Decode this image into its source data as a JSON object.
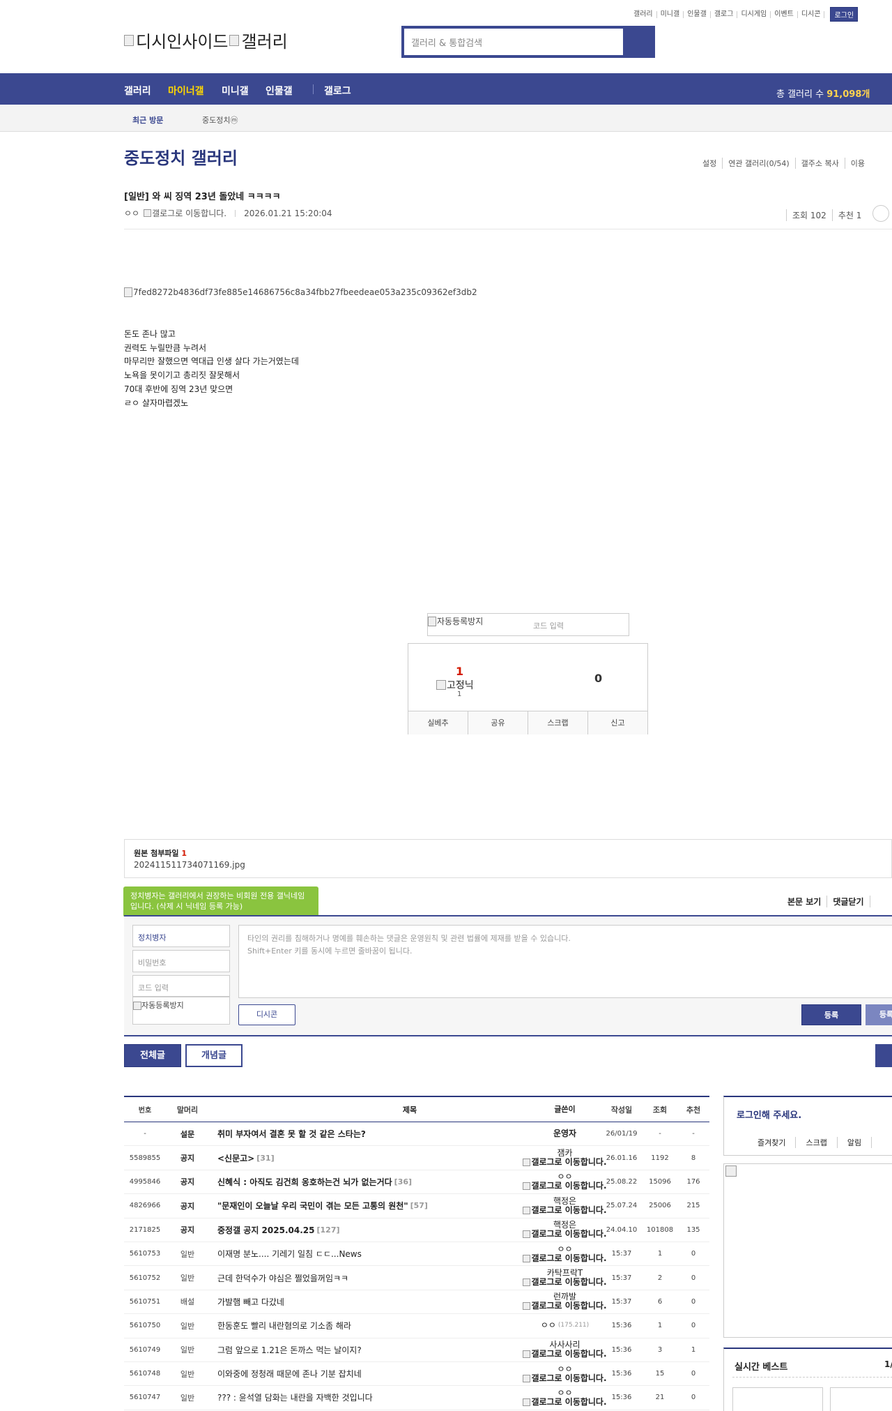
{
  "top_links": [
    "갤러리",
    "미니갤",
    "인물갤",
    "갤로그",
    "디시게임",
    "이벤트",
    "디시콘"
  ],
  "login_label": "로그인",
  "logo": {
    "left": "디시인사이드",
    "right": "갤러리"
  },
  "search": {
    "placeholder": "갤러리 & 통합검색"
  },
  "gnb": {
    "items": [
      "갤러리",
      "마이너갤",
      "미니갤",
      "인물갤",
      "갤로그"
    ],
    "active": "마이너갤",
    "total_label": "총 갤러리 수",
    "total_value": "91,098개"
  },
  "recent": {
    "label": "최근 방문",
    "gallery": "중도정치",
    "badge": "ⓜ"
  },
  "gallery_title": "중도정치 갤러리",
  "gallery_tools": [
    "설정",
    "연관 갤러리(0/54)",
    "갤주소 복사",
    "이용"
  ],
  "post": {
    "title": "[일반] 와 씨 징역 23년 돌았네 ㅋㅋㅋㅋ",
    "author": "ㅇㅇ",
    "gallog_alt": "갤로그로 이동합니다.",
    "date": "2026.01.21 15:20:04",
    "views": "조회 102",
    "recommend": "추천 1",
    "image_alt": "7fed8272b4836df73fe885e14686756c8a34fbb27fbeedeae053a235c09362ef3db2",
    "content_lines": [
      "돈도 존나 많고",
      "권력도 누릴만큼 누려서",
      "마무리만 잘했으면 역대급 인생 살다 가는거였는데",
      "노욕을 못이기고 총리짓 잘못해서",
      "70대 후반에 징역 23년 맞으면",
      "ㄹㅇ 살자마렵겠노"
    ]
  },
  "captcha": {
    "alt": "자동등록방지",
    "placeholder": "코드 입력"
  },
  "rec": {
    "up": "1",
    "fixnick": "고정닉",
    "fixnick_count": "1",
    "down": "0",
    "buttons": [
      "실베추",
      "공유",
      "스크랩",
      "신고"
    ]
  },
  "attach": {
    "label": "원본 첨부파일",
    "count": "1",
    "file": "202411511734071169.jpg"
  },
  "comment": {
    "tooltip": "정치병자는 갤러리에서 권장하는 비회원 전용 갤닉네임입니다. (삭제 시 닉네임 등록 가능)",
    "tabs": [
      "본문 보기",
      "댓글닫기"
    ],
    "nick": "정치병자",
    "password": "비밀번호",
    "code": "코드 입력",
    "captcha_alt": "자동등록방지",
    "text_line1": "타인의 권리를 침해하거나 명예를 훼손하는 댓글은 운영원칙 및 관련 법률에 제재를 받을 수 있습니다.",
    "text_line2": "Shift+Enter 키를 동시에 누르면 줄바꿈이 됩니다.",
    "dccon": "디시콘",
    "register": "등록",
    "register2": "등록"
  },
  "list_buttons": {
    "all": "전체글",
    "concept": "개념글"
  },
  "table": {
    "headers": [
      "번호",
      "말머리",
      "제목",
      "글쓴이",
      "작성일",
      "조회",
      "추천"
    ],
    "rows": [
      {
        "num": "-",
        "head": "설문",
        "title": "취미 부자여서 결혼 못 할 것 같은 스타는?",
        "count": "",
        "writer": "운영자",
        "writer_gm": false,
        "ip": "",
        "date": "26/01/19",
        "views": "-",
        "rec": "-",
        "notice": true
      },
      {
        "num": "5589855",
        "head": "공지",
        "title": "<신문고>",
        "count": "[31]",
        "writer": "잼카",
        "writer_gm": true,
        "ip": "",
        "date": "26.01.16",
        "views": "1192",
        "rec": "8",
        "notice": true
      },
      {
        "num": "4995846",
        "head": "공지",
        "title": "신혜식 : 아직도 김건희 옹호하는건 뇌가 없는거다",
        "count": "[36]",
        "writer": "ㅇㅇ",
        "writer_gm": true,
        "ip": "",
        "date": "25.08.22",
        "views": "15096",
        "rec": "176",
        "notice": true
      },
      {
        "num": "4826966",
        "head": "공지",
        "title": "\"문재인이 오늘날 우리 국민이 겪는 모든 고통의 원천\"",
        "count": "[57]",
        "writer": "핵정은",
        "writer_gm": true,
        "ip": "",
        "date": "25.07.24",
        "views": "25006",
        "rec": "215",
        "notice": true
      },
      {
        "num": "2171825",
        "head": "공지",
        "title": "중정갤 공지 2025.04.25",
        "count": "[127]",
        "writer": "핵정은",
        "writer_gm": true,
        "ip": "",
        "date": "24.04.10",
        "views": "101808",
        "rec": "135",
        "notice": true
      },
      {
        "num": "5610753",
        "head": "일반",
        "title": "이재명 분노.... 기레기 일침 ㄷㄷ...News",
        "count": "",
        "writer": "ㅇㅇ",
        "writer_gm": true,
        "ip": "",
        "date": "15:37",
        "views": "1",
        "rec": "0",
        "notice": false
      },
      {
        "num": "5610752",
        "head": "일반",
        "title": "근데 한덕수가 야심은 쩔었을꺼임ㅋㅋ",
        "count": "",
        "writer": "카탁프락T",
        "writer_gm": true,
        "ip": "",
        "date": "15:37",
        "views": "2",
        "rec": "0",
        "notice": false
      },
      {
        "num": "5610751",
        "head": "배설",
        "title": "가발햄 빼고 다갔네",
        "count": "",
        "writer": "런까발",
        "writer_gm": true,
        "ip": "",
        "date": "15:37",
        "views": "6",
        "rec": "0",
        "notice": false
      },
      {
        "num": "5610750",
        "head": "일반",
        "title": "한동훈도 빨리 내란혐의로 기소좀 해라",
        "count": "",
        "writer": "ㅇㅇ",
        "writer_gm": false,
        "ip": "(175.211)",
        "date": "15:36",
        "views": "1",
        "rec": "0",
        "notice": false
      },
      {
        "num": "5610749",
        "head": "일반",
        "title": "그럼 앞으로 1.21은 돈까스 먹는 날이지?",
        "count": "",
        "writer": "사사사리",
        "writer_gm": true,
        "ip": "",
        "date": "15:36",
        "views": "3",
        "rec": "1",
        "notice": false
      },
      {
        "num": "5610748",
        "head": "일반",
        "title": "이와중에 정청래 때문에 존나 기분 잡치네",
        "count": "",
        "writer": "ㅇㅇ",
        "writer_gm": true,
        "ip": "",
        "date": "15:36",
        "views": "15",
        "rec": "0",
        "notice": false
      },
      {
        "num": "5610747",
        "head": "일반",
        "title": "??? : 윤석열 담화는 내란을 자백한 것입니다",
        "count": "",
        "writer": "ㅇㅇ",
        "writer_gm": true,
        "ip": "",
        "date": "15:36",
        "views": "21",
        "rec": "0",
        "notice": false
      }
    ],
    "gallog_alt": "갤로그로 이동합니다."
  },
  "side": {
    "login_title": "로그인해 주세요.",
    "login_links": [
      "즐겨찾기",
      "스크랩",
      "알림"
    ],
    "best_title": "실시간 베스트",
    "best_page": "1/"
  },
  "colors": {
    "brand": "#3b4890",
    "brand_dark": "#29367c",
    "tooltip": "#8ac43f",
    "active_nav": "#ffd700"
  }
}
